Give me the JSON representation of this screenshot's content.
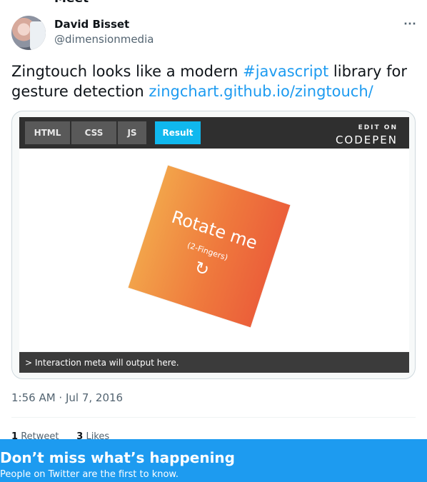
{
  "header": {
    "cut_text": "Meet"
  },
  "author": {
    "name": "David Bisset",
    "handle": "@dimensionmedia"
  },
  "tweet": {
    "text_before": "Zingtouch looks like a modern ",
    "hashtag": "#javascript",
    "text_middle": " library for gesture detection ",
    "link": "zingchart.github.io/zingtouch/"
  },
  "codepen": {
    "tabs": [
      "HTML",
      "CSS",
      "JS",
      "Result"
    ],
    "edit_on": "EDIT ON",
    "brand": "CODEPEN",
    "demo_title": "Rotate me",
    "demo_subtitle": "(2-Fingers)",
    "demo_icon": "↻",
    "console_text": "> Interaction meta will output here."
  },
  "meta": {
    "timestamp": "1:56 AM · Jul 7, 2016",
    "retweet_count": "1",
    "retweet_label": "Retweet",
    "like_count": "3",
    "like_label": "Likes"
  },
  "banner": {
    "title": "Don’t miss what’s happening",
    "subtitle": "People on Twitter are the first to know."
  },
  "colors": {
    "accent": "#1d9bf0",
    "codepen_result": "#10b8ee"
  }
}
